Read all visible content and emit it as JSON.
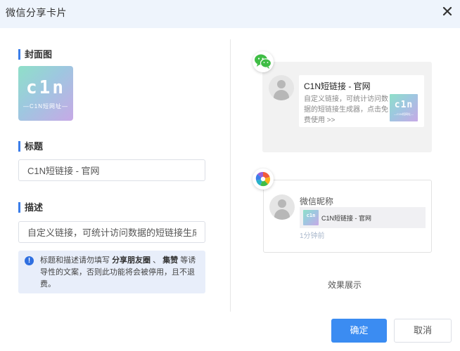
{
  "dialog": {
    "title": "微信分享卡片"
  },
  "form": {
    "cover_label": "封面图",
    "title_label": "标题",
    "title_value": "C1N短链接 - 官网",
    "desc_label": "描述",
    "desc_value": "自定义链接，可统计访问数据的短链接生成器"
  },
  "cover": {
    "big_text": "c1n",
    "small_text": "—C1N短网址—"
  },
  "notice": {
    "text_1": "标题和描述请勿填写",
    "bold_1": "分享朋友圈",
    "sep": "、",
    "bold_2": "集赞",
    "text_2": "等诱导性的文案，否则此功能将会被停用，且不退费。"
  },
  "preview": {
    "chat_card_title": "C1N短链接 - 官网",
    "chat_card_desc": "自定义链接，可统计访问数据的短链接生成器，点击免费使用 >>",
    "nickname": "微信昵称",
    "moments_card_title": "C1N短链接 - 官网",
    "time": "1分钟前",
    "caption": "效果展示"
  },
  "buttons": {
    "ok": "确定",
    "cancel": "取消"
  },
  "icons": {
    "close": "close-icon",
    "wechat": "wechat-icon",
    "moments": "moments-icon",
    "info": "info-icon",
    "avatar": "avatar-placeholder"
  },
  "colors": {
    "accent": "#3b8cf2",
    "label_bar": "#3b7de9",
    "header_bg": "#eef4fc",
    "notice_bg": "#e8eefa",
    "wechat_green": "#3fbd45"
  }
}
